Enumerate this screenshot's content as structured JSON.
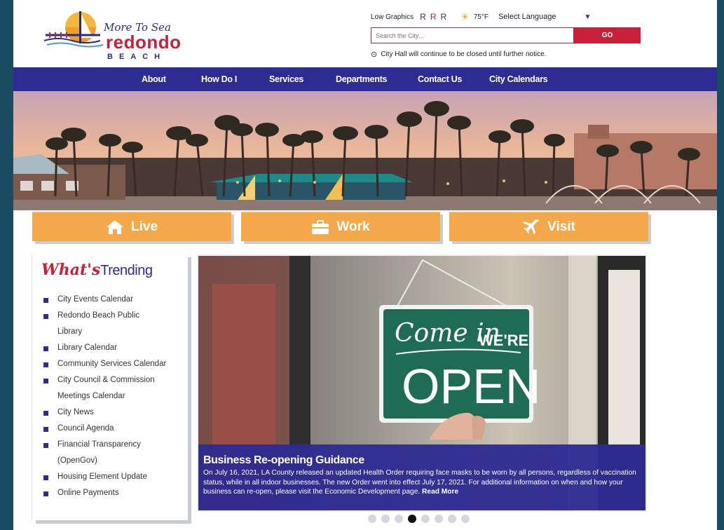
{
  "logo": {
    "tagline": "More To Sea",
    "name": "redondo",
    "beach": "BEACH"
  },
  "utility": {
    "low_graphics": "Low Graphics",
    "r_sizes": [
      "R",
      "R",
      "R"
    ],
    "temperature": "75°F",
    "language": "Select Language"
  },
  "search": {
    "placeholder": "Search the City...",
    "go": "GO"
  },
  "notice": "City Hall will continue to be closed until further notice.",
  "nav": [
    "About",
    "How Do I",
    "Services",
    "Departments",
    "Contact Us",
    "City Calendars"
  ],
  "big_buttons": [
    {
      "label": "Live",
      "icon": "home-icon"
    },
    {
      "label": "Work",
      "icon": "briefcase-icon"
    },
    {
      "label": "Visit",
      "icon": "plane-icon"
    }
  ],
  "trending": {
    "title_script": "What's",
    "title": "Trending",
    "items": [
      "City Events Calendar",
      "Redondo Beach Public",
      "Library",
      "Library Calendar",
      "Community Services Calendar",
      "City Council & Commission",
      "Meetings Calendar",
      "City News",
      "Council Agenda",
      "Financial Transparency",
      "(OpenGov)",
      "Housing Element Update",
      "Online Payments"
    ]
  },
  "slide": {
    "sign_line1": "Come in",
    "sign_line2": "WE'RE",
    "sign_line3": "OPEN",
    "title": "Business Re-opening Guidance",
    "body": "On July 16, 2021, LA County released an updated Health Order requiring face masks to be worn by all persons, regardless of vaccination status, while in all indoor businesses. The new Order went into effect July 17, 2021. For additional information on when and how your business can re-open, please visit the Economic Development page.",
    "read_more": "Read More"
  },
  "slider_dots": {
    "count": 8,
    "active": 4
  },
  "colors": {
    "navy": "#2e2c92",
    "red": "#c8203a",
    "orange": "#f3a94a",
    "page_bg": "#1b4a63"
  }
}
